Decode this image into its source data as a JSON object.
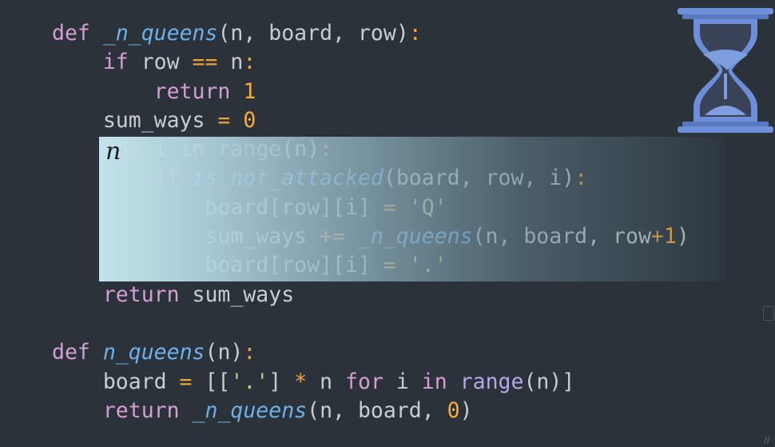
{
  "code_lines": [
    {
      "tokens": [
        {
          "t": "def",
          "c": "kw"
        },
        {
          "t": " ",
          "c": "txt"
        },
        {
          "t": "_n_queens",
          "c": "fn"
        },
        {
          "t": "(n, board, row)",
          "c": "punc"
        },
        {
          "t": ":",
          "c": "op"
        }
      ]
    },
    {
      "tokens": [
        {
          "t": "    ",
          "c": "txt"
        },
        {
          "t": "if",
          "c": "kw"
        },
        {
          "t": " row ",
          "c": "txt"
        },
        {
          "t": "==",
          "c": "op"
        },
        {
          "t": " n",
          "c": "txt"
        },
        {
          "t": ":",
          "c": "op"
        }
      ]
    },
    {
      "tokens": [
        {
          "t": "        ",
          "c": "txt"
        },
        {
          "t": "return",
          "c": "kw"
        },
        {
          "t": " ",
          "c": "txt"
        },
        {
          "t": "1",
          "c": "num"
        }
      ]
    },
    {
      "tokens": [
        {
          "t": "    sum_ways ",
          "c": "txt"
        },
        {
          "t": "=",
          "c": "op"
        },
        {
          "t": " ",
          "c": "txt"
        },
        {
          "t": "0",
          "c": "num"
        }
      ]
    },
    {
      "tokens": [
        {
          "t": "    ",
          "c": "txt"
        },
        {
          "t": "for",
          "c": "kw"
        },
        {
          "t": " i ",
          "c": "txt"
        },
        {
          "t": "in",
          "c": "kw"
        },
        {
          "t": " ",
          "c": "txt"
        },
        {
          "t": "range",
          "c": "bi"
        },
        {
          "t": "(n)",
          "c": "punc"
        },
        {
          "t": ":",
          "c": "op"
        }
      ]
    },
    {
      "tokens": [
        {
          "t": "        ",
          "c": "txt"
        },
        {
          "t": "if",
          "c": "kw"
        },
        {
          "t": " ",
          "c": "txt"
        },
        {
          "t": "is_not_attacked",
          "c": "fn"
        },
        {
          "t": "(board, row, i)",
          "c": "punc"
        },
        {
          "t": ":",
          "c": "op"
        }
      ]
    },
    {
      "tokens": [
        {
          "t": "            board[row][i] ",
          "c": "txt"
        },
        {
          "t": "=",
          "c": "op"
        },
        {
          "t": " ",
          "c": "txt"
        },
        {
          "t": "'Q'",
          "c": "str"
        }
      ]
    },
    {
      "tokens": [
        {
          "t": "            sum_ways ",
          "c": "txt"
        },
        {
          "t": "+=",
          "c": "op"
        },
        {
          "t": " ",
          "c": "txt"
        },
        {
          "t": "_n_queens",
          "c": "fn"
        },
        {
          "t": "(n, board, row",
          "c": "punc"
        },
        {
          "t": "+",
          "c": "op"
        },
        {
          "t": "1",
          "c": "num"
        },
        {
          "t": ")",
          "c": "punc"
        }
      ]
    },
    {
      "tokens": [
        {
          "t": "            board[row][i] ",
          "c": "txt"
        },
        {
          "t": "=",
          "c": "op"
        },
        {
          "t": " ",
          "c": "txt"
        },
        {
          "t": "'.'",
          "c": "str"
        }
      ]
    },
    {
      "tokens": [
        {
          "t": "    ",
          "c": "txt"
        },
        {
          "t": "return",
          "c": "kw"
        },
        {
          "t": " sum_ways",
          "c": "txt"
        }
      ]
    },
    {
      "tokens": [
        {
          "t": "",
          "c": "txt"
        }
      ]
    },
    {
      "tokens": [
        {
          "t": "def",
          "c": "kw"
        },
        {
          "t": " ",
          "c": "txt"
        },
        {
          "t": "n_queens",
          "c": "fn"
        },
        {
          "t": "(n)",
          "c": "punc"
        },
        {
          "t": ":",
          "c": "op"
        }
      ]
    },
    {
      "tokens": [
        {
          "t": "    board ",
          "c": "txt"
        },
        {
          "t": "=",
          "c": "op"
        },
        {
          "t": " [[",
          "c": "punc"
        },
        {
          "t": "'.'",
          "c": "str"
        },
        {
          "t": "] ",
          "c": "punc"
        },
        {
          "t": "*",
          "c": "op"
        },
        {
          "t": " n ",
          "c": "txt"
        },
        {
          "t": "for",
          "c": "kw"
        },
        {
          "t": " i ",
          "c": "txt"
        },
        {
          "t": "in",
          "c": "kw"
        },
        {
          "t": " ",
          "c": "txt"
        },
        {
          "t": "range",
          "c": "bi"
        },
        {
          "t": "(n)]",
          "c": "punc"
        }
      ]
    },
    {
      "tokens": [
        {
          "t": "    ",
          "c": "txt"
        },
        {
          "t": "return",
          "c": "kw"
        },
        {
          "t": " ",
          "c": "txt"
        },
        {
          "t": "_n_queens",
          "c": "fn"
        },
        {
          "t": "(n, board, ",
          "c": "punc"
        },
        {
          "t": "0",
          "c": "num"
        },
        {
          "t": ")",
          "c": "punc"
        }
      ]
    }
  ],
  "highlight_glyph": "n",
  "icons": {
    "hourglass": "hourglass-icon",
    "scroll_marker": "scroll-marker-icon",
    "corner_resize": "resize-grip-icon"
  },
  "colors": {
    "background": "#2b323a",
    "keyword": "#d49ed2",
    "function": "#6fb0e8",
    "builtin": "#b2a8e6",
    "operator": "#e8a23a",
    "number": "#f5ad3e",
    "string": "#b6d38a",
    "text": "#c8cdd2",
    "hourglass_frame": "#6d8fd9",
    "hourglass_sand": "#47546b"
  }
}
